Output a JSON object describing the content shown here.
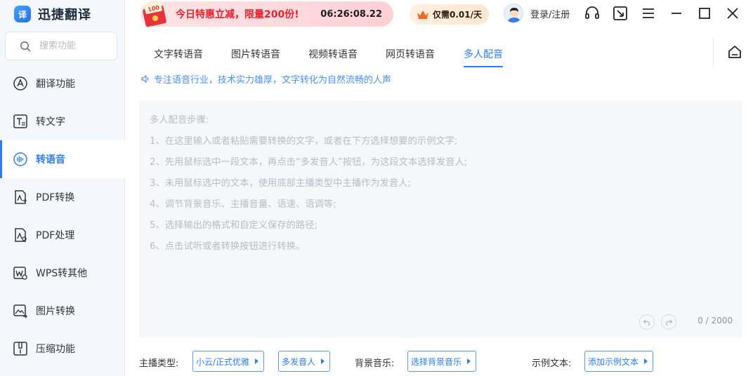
{
  "app": {
    "title": "迅捷翻译",
    "logo_mark": "译"
  },
  "search": {
    "placeholder": "搜索功能"
  },
  "sidebar": {
    "items": [
      {
        "label": "翻译功能",
        "icon": "translate-icon"
      },
      {
        "label": "转文字",
        "icon": "text-convert-icon"
      },
      {
        "label": "转语音",
        "icon": "voice-wave-icon",
        "active": true
      },
      {
        "label": "PDF转换",
        "icon": "pdf-convert-icon"
      },
      {
        "label": "PDF处理",
        "icon": "pdf-process-icon"
      },
      {
        "label": "WPS转其他",
        "icon": "wps-convert-icon"
      },
      {
        "label": "图片转换",
        "icon": "image-convert-icon"
      },
      {
        "label": "压缩功能",
        "icon": "compress-icon"
      }
    ]
  },
  "header": {
    "promo_badge": "100",
    "promo_text": "今日特惠立减，限量200份!",
    "promo_timer": "06:26:08.22",
    "vip_text": "仅需0.01/天",
    "login_label": "登录/注册"
  },
  "tabs": [
    {
      "label": "文字转语音"
    },
    {
      "label": "图片转语音"
    },
    {
      "label": "视频转语音"
    },
    {
      "label": "网页转语音"
    },
    {
      "label": "多人配音",
      "active": true
    }
  ],
  "notice": "专注语音行业，技术实力雄厚，文字转化为自然流畅的人声",
  "editor": {
    "placeholder": "多人配音步骤:\n1、在这里输入或者粘贴需要转换的文字，或者在下方选择想要的示例文字;\n2、先用鼠标选中一段文本，再点击“多发音人”按钮，为这段文本选择发音人;\n3、未用鼠标选中的文本，使用底部主播类型中主播作为发音人;\n4、调节背景音乐、主播音量、语速、语调等;\n5、选择输出的格式和自定义保存的路径;\n6、点击试听或者转换按钮进行转换。",
    "value": "",
    "count": "0 / 2000"
  },
  "controls": {
    "anchor_label": "主播类型:",
    "anchor_value": "小云/正式优雅",
    "multi_speaker": "多发音人",
    "bgm_label": "背景音乐:",
    "bgm_value": "选择背景音乐",
    "sample_label": "示例文本:",
    "sample_value": "添加示例文本"
  },
  "colors": {
    "accent": "#2b7cf6",
    "promo_red": "#e5212d",
    "sidebar_bg": "#f4f7fc"
  }
}
